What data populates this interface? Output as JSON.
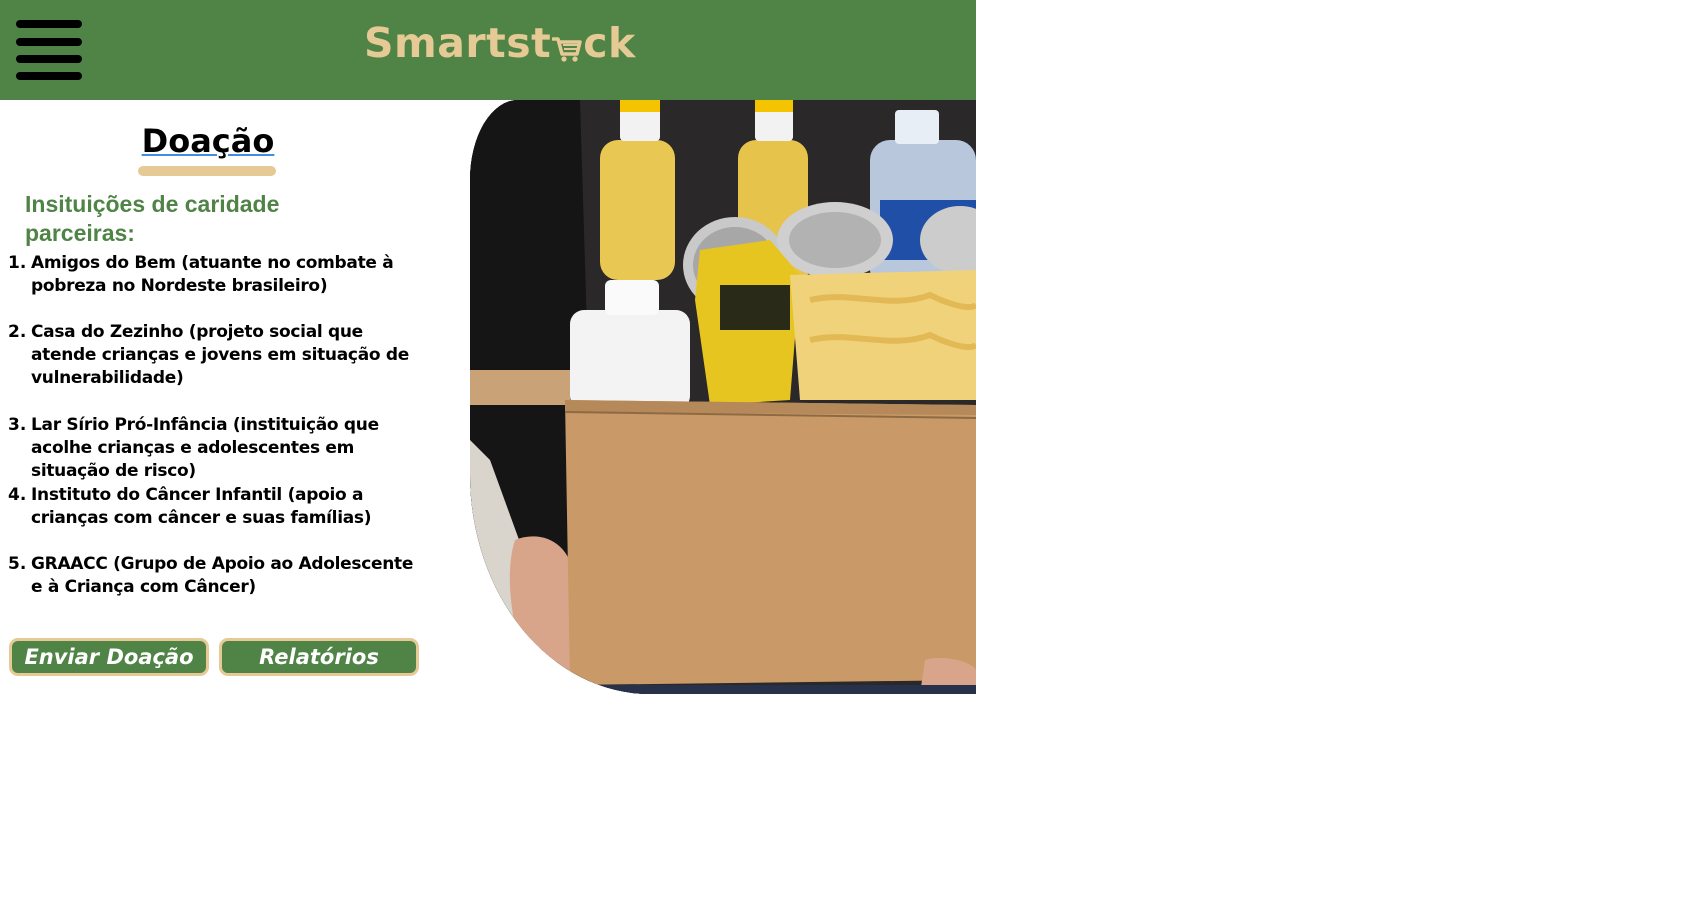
{
  "header": {
    "logo_text_start": "Smartst",
    "logo_text_end": "ck",
    "logo_icon": "shopping-cart-icon",
    "menu_icon": "hamburger-menu-icon"
  },
  "main": {
    "title": "Doação",
    "subtitle": "Insituições de caridade parceiras:",
    "charities": [
      {
        "number": "1.",
        "text": "Amigos do Bem (atuante no combate à pobreza no Nordeste brasileiro)"
      },
      {
        "number": "2.",
        "text": "Casa do Zezinho (projeto social que atende crianças e jovens em situação de vulnerabilidade)"
      },
      {
        "number": "3.",
        "text": "Lar Sírio Pró-Infância (instituição que acolhe crianças e adolescentes em situação de risco)"
      },
      {
        "number": "4.",
        "text": "Instituto do Câncer Infantil (apoio a crianças com câncer e suas famílias)"
      },
      {
        "number": "5.",
        "text": "GRAACC (Grupo de Apoio ao Adolescente e à Criança com Câncer)"
      }
    ],
    "buttons": {
      "donate": "Enviar Doação",
      "reports": "Relatórios"
    }
  },
  "colors": {
    "brand_green": "#4f8446",
    "accent_beige": "#e6ca95",
    "link_blue": "#3f8ee0"
  }
}
